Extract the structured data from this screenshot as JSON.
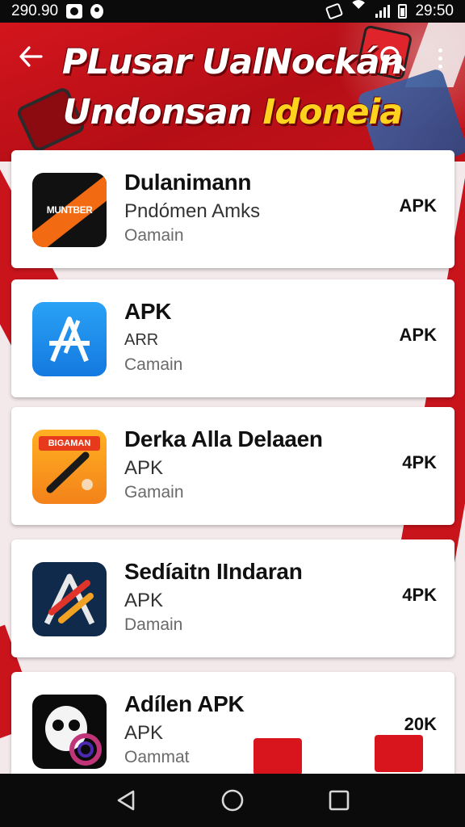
{
  "status_bar": {
    "left_time": "290.90",
    "right_time": "29:50",
    "icons": [
      "screenshot-icon",
      "location-icon",
      "vibrate-icon",
      "wifi-icon",
      "signal-icon",
      "battery-icon"
    ]
  },
  "header": {
    "title_line1": "PLusar UalNockán",
    "title_line2_main": "Undonsan ",
    "title_line2_accent": "Idoneia",
    "back_icon": "back-arrow-icon",
    "search_icon": "search-icon",
    "menu_icon": "more-vert-icon",
    "accent_color": "#ffd21e",
    "brand_color": "#d3151d"
  },
  "apps": [
    {
      "name": "Dulanimann",
      "subtitle": "Pndómen Amks",
      "category": "Oamain",
      "badge": "APK",
      "icon_text": "MUNTBER",
      "icon": "app-icon-orange-sash"
    },
    {
      "name": "APK",
      "subtitle": "ARR",
      "category": "Camain",
      "badge": "APK",
      "icon": "app-icon-blue-a"
    },
    {
      "name": "Derka Alla Delaaen",
      "subtitle": "APK",
      "category": "Gamain",
      "badge": "4PK",
      "icon_text": "BIGAMAN",
      "icon": "app-icon-pen"
    },
    {
      "name": "Sedíaitn IIndaran",
      "subtitle": "APK",
      "category": "Damain",
      "badge": "4PK",
      "icon": "app-icon-pencil-a"
    },
    {
      "name": "Adílen APK",
      "subtitle": "APK",
      "category": "Oammat",
      "badge": "20K",
      "icon": "app-icon-skull"
    }
  ],
  "nav_bar": {
    "back": "nav-back-icon",
    "home": "nav-home-icon",
    "recents": "nav-recents-icon"
  }
}
